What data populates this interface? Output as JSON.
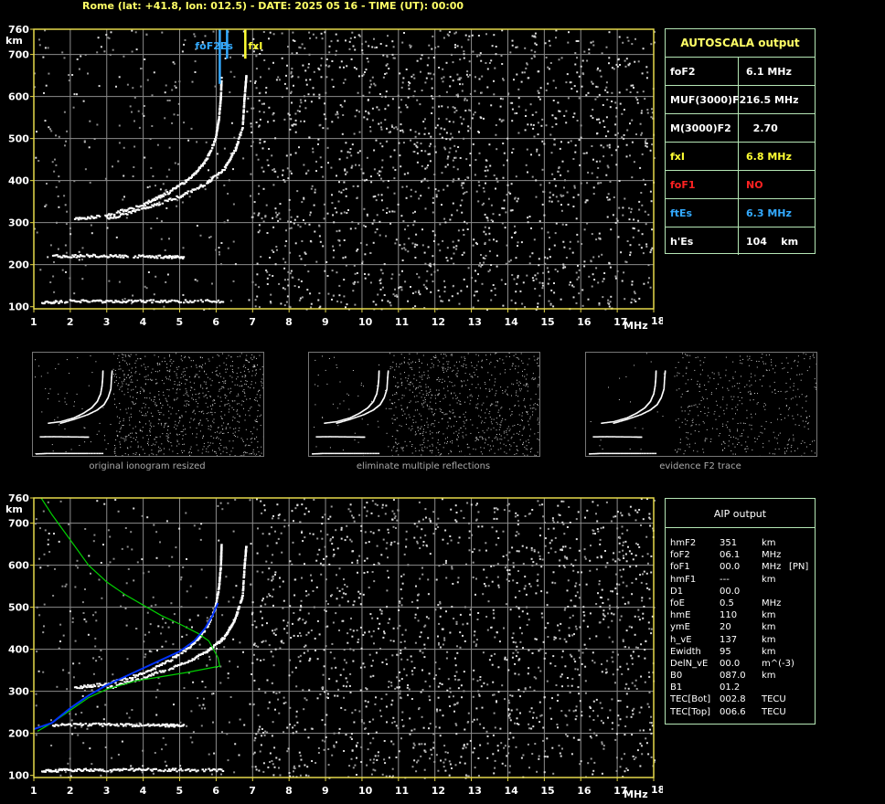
{
  "header": "Rome (lat: +41.8, lon: 012.5) - DATE: 2025 05 16 - TIME (UT): 00:00",
  "colors": {
    "axis": "#e6d94a",
    "grid": "#8c8c8c",
    "trace": "#ffffff",
    "green": "#00d000",
    "blue": "#0033ff",
    "yellow": "#ffff33",
    "cyan": "#33aaff"
  },
  "autoscala": {
    "title": "AUTOSCALA output",
    "rows": [
      {
        "label": "foF2",
        "value": "6.1 MHz",
        "color": "#ffffff"
      },
      {
        "label": "MUF(3000)F2",
        "value": "16.5 MHz",
        "color": "#ffffff"
      },
      {
        "label": "M(3000)F2",
        "value": "  2.70",
        "color": "#ffffff"
      },
      {
        "label": "fxI",
        "value": "6.8 MHz",
        "color": "#ffff33"
      },
      {
        "label": "foF1",
        "value": "NO",
        "color": "#ff2222"
      },
      {
        "label": "ftEs",
        "value": "6.3 MHz",
        "color": "#33aaff"
      },
      {
        "label": "h'Es",
        "value": "104    km",
        "color": "#ffffff"
      }
    ]
  },
  "aip": {
    "title": "AIP output",
    "rows": [
      [
        "hmF2",
        "351",
        "km",
        ""
      ],
      [
        "foF2",
        "06.1",
        "MHz",
        ""
      ],
      [
        "foF1",
        "00.0",
        "MHz",
        "[PN]"
      ],
      [
        "hmF1",
        "---",
        "km",
        ""
      ],
      [
        "D1",
        "00.0",
        "",
        ""
      ],
      [
        "foE",
        "0.5",
        "MHz",
        ""
      ],
      [
        "hmE",
        "110",
        "km",
        ""
      ],
      [
        "ymE",
        "20",
        "km",
        ""
      ],
      [
        "h_vE",
        "137",
        "km",
        ""
      ],
      [
        "Ewidth",
        "95",
        "km",
        ""
      ],
      [
        "DelN_vE",
        "00.0",
        "m^(-3)",
        ""
      ],
      [
        "B0",
        "087.0",
        "km",
        ""
      ],
      [
        "B1",
        "01.2",
        "",
        ""
      ],
      [
        "TEC[Bot]",
        "002.8",
        "TECU",
        ""
      ],
      [
        "TEC[Top]",
        "006.6",
        "TECU",
        ""
      ]
    ]
  },
  "thumbs": [
    "original ionogram resized",
    "eliminate multiple reflections",
    "evidence F2 trace"
  ],
  "chart_data": [
    {
      "type": "scatter",
      "xlabel": "MHz",
      "ylabel": "km",
      "xlim": [
        1,
        18
      ],
      "ylim": [
        95,
        760
      ],
      "xticks": [
        "1",
        "2",
        "3",
        "4",
        "5",
        "6",
        "7",
        "8",
        "9",
        "10",
        "11",
        "12",
        "13",
        "14",
        "15",
        "16",
        "17",
        "18"
      ],
      "yticks": [
        "100",
        "200",
        "300",
        "400",
        "500",
        "600",
        "700",
        "760"
      ],
      "grid": true,
      "traces": [
        {
          "name": "F2 o-trace",
          "points": [
            [
              2.1,
              310
            ],
            [
              3.0,
              320
            ],
            [
              4.0,
              345
            ],
            [
              4.7,
              375
            ],
            [
              5.3,
              410
            ],
            [
              5.7,
              450
            ],
            [
              5.95,
              500
            ],
            [
              6.05,
              550
            ],
            [
              6.1,
              600
            ],
            [
              6.12,
              650
            ]
          ]
        },
        {
          "name": "F2 x-trace",
          "points": [
            [
              3.0,
              310
            ],
            [
              4.0,
              335
            ],
            [
              5.0,
              365
            ],
            [
              5.7,
              395
            ],
            [
              6.2,
              430
            ],
            [
              6.5,
              475
            ],
            [
              6.7,
              530
            ],
            [
              6.75,
              600
            ],
            [
              6.8,
              650
            ]
          ]
        },
        {
          "name": "E layer",
          "points": [
            [
              1.2,
              112
            ],
            [
              2.0,
              115
            ],
            [
              3.0,
              115
            ],
            [
              4.0,
              115
            ],
            [
              5.0,
              115
            ],
            [
              6.2,
              115
            ]
          ]
        },
        {
          "name": "E second hop",
          "points": [
            [
              1.5,
              222
            ],
            [
              2.5,
              223
            ],
            [
              3.5,
              222
            ],
            [
              4.5,
              221
            ],
            [
              5.1,
              220
            ]
          ]
        }
      ],
      "markers": [
        {
          "label": "foF2",
          "x": 6.1,
          "color": "#33aaff"
        },
        {
          "label": "ftEs",
          "x": 6.3,
          "color": "#33aaff"
        },
        {
          "label": "fxI",
          "x": 6.8,
          "color": "#ffff33"
        }
      ],
      "marker_text": [
        "foF2",
        "ftEs",
        "fxI"
      ]
    },
    {
      "type": "line",
      "xlabel": "MHz",
      "ylabel": "km",
      "xlim": [
        1,
        18
      ],
      "ylim": [
        95,
        760
      ],
      "xticks": [
        "1",
        "2",
        "3",
        "4",
        "5",
        "6",
        "7",
        "8",
        "9",
        "10",
        "11",
        "12",
        "13",
        "14",
        "15",
        "16",
        "17",
        "18"
      ],
      "yticks": [
        "100",
        "200",
        "300",
        "400",
        "500",
        "600",
        "700",
        "760"
      ],
      "grid": true,
      "series": [
        {
          "color": "#00d000",
          "points": [
            [
              1.2,
              760
            ],
            [
              1.5,
              720
            ],
            [
              2.0,
              660
            ],
            [
              2.5,
              600
            ],
            [
              3.0,
              560
            ],
            [
              3.5,
              530
            ],
            [
              4.0,
              505
            ],
            [
              4.5,
              480
            ],
            [
              5.0,
              460
            ],
            [
              5.5,
              438
            ],
            [
              5.8,
              420
            ],
            [
              6.05,
              380
            ],
            [
              6.1,
              360
            ],
            [
              5.8,
              355
            ],
            [
              5.2,
              345
            ],
            [
              4.5,
              335
            ],
            [
              3.8,
              325
            ],
            [
              3.0,
              305
            ],
            [
              2.5,
              285
            ],
            [
              2.0,
              255
            ],
            [
              1.5,
              225
            ],
            [
              1.1,
              205
            ]
          ]
        },
        {
          "color": "#0033ff",
          "points": [
            [
              1.0,
              210
            ],
            [
              1.5,
              225
            ],
            [
              2.0,
              260
            ],
            [
              2.5,
              290
            ],
            [
              3.0,
              315
            ],
            [
              3.5,
              335
            ],
            [
              4.0,
              355
            ],
            [
              4.5,
              375
            ],
            [
              5.0,
              395
            ],
            [
              5.4,
              420
            ],
            [
              5.7,
              450
            ],
            [
              5.9,
              480
            ],
            [
              6.05,
              510
            ]
          ]
        }
      ],
      "traces_ref": "same as first chart"
    }
  ]
}
